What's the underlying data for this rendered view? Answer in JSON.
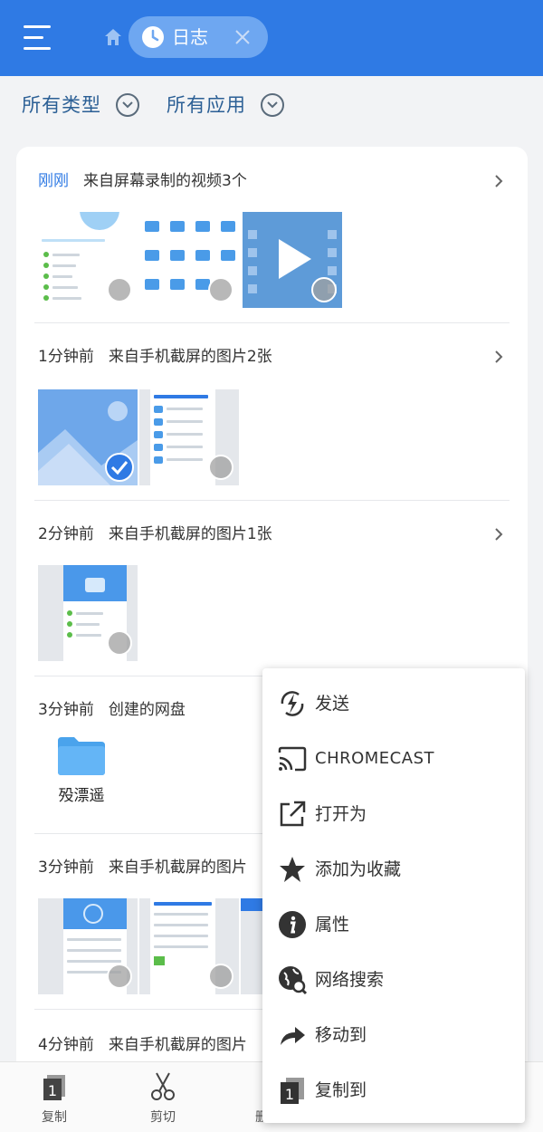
{
  "header": {
    "tab_label": "日志",
    "icons": {
      "menu": "hamburger-menu-icon",
      "home": "home-icon",
      "tab": "clock-icon",
      "close": "close-icon"
    },
    "accent": "#2f7ae4"
  },
  "filters": [
    {
      "label": "所有类型"
    },
    {
      "label": "所有应用"
    }
  ],
  "sections": [
    {
      "time": "刚刚",
      "desc": "来自屏幕录制的视频3个"
    },
    {
      "time": "1分钟前",
      "desc": "来自手机截屏的图片2张"
    },
    {
      "time": "2分钟前",
      "desc": "来自手机截屏的图片1张"
    },
    {
      "time": "3分钟前",
      "desc": "创建的网盘"
    },
    {
      "time": "3分钟前",
      "desc": "来自手机截屏的图片"
    },
    {
      "time": "4分钟前",
      "desc": "来自手机截屏的图片"
    }
  ],
  "folder": {
    "name": "殁漂遥"
  },
  "toolbar": [
    {
      "label": "复制",
      "icon": "copy-icon"
    },
    {
      "label": "剪切",
      "icon": "scissors-icon"
    },
    {
      "label": "删",
      "icon": "delete-icon"
    }
  ],
  "context_menu": [
    {
      "label": "发送",
      "icon": "send-lightning-icon"
    },
    {
      "label": "CHROMECAST",
      "icon": "cast-icon"
    },
    {
      "label": "打开为",
      "icon": "open-external-icon"
    },
    {
      "label": "添加为收藏",
      "icon": "star-icon"
    },
    {
      "label": "属性",
      "icon": "info-icon"
    },
    {
      "label": "网络搜索",
      "icon": "globe-search-icon"
    },
    {
      "label": "移动到",
      "icon": "move-arrow-icon"
    },
    {
      "label": "复制到",
      "icon": "copy-to-icon"
    }
  ]
}
